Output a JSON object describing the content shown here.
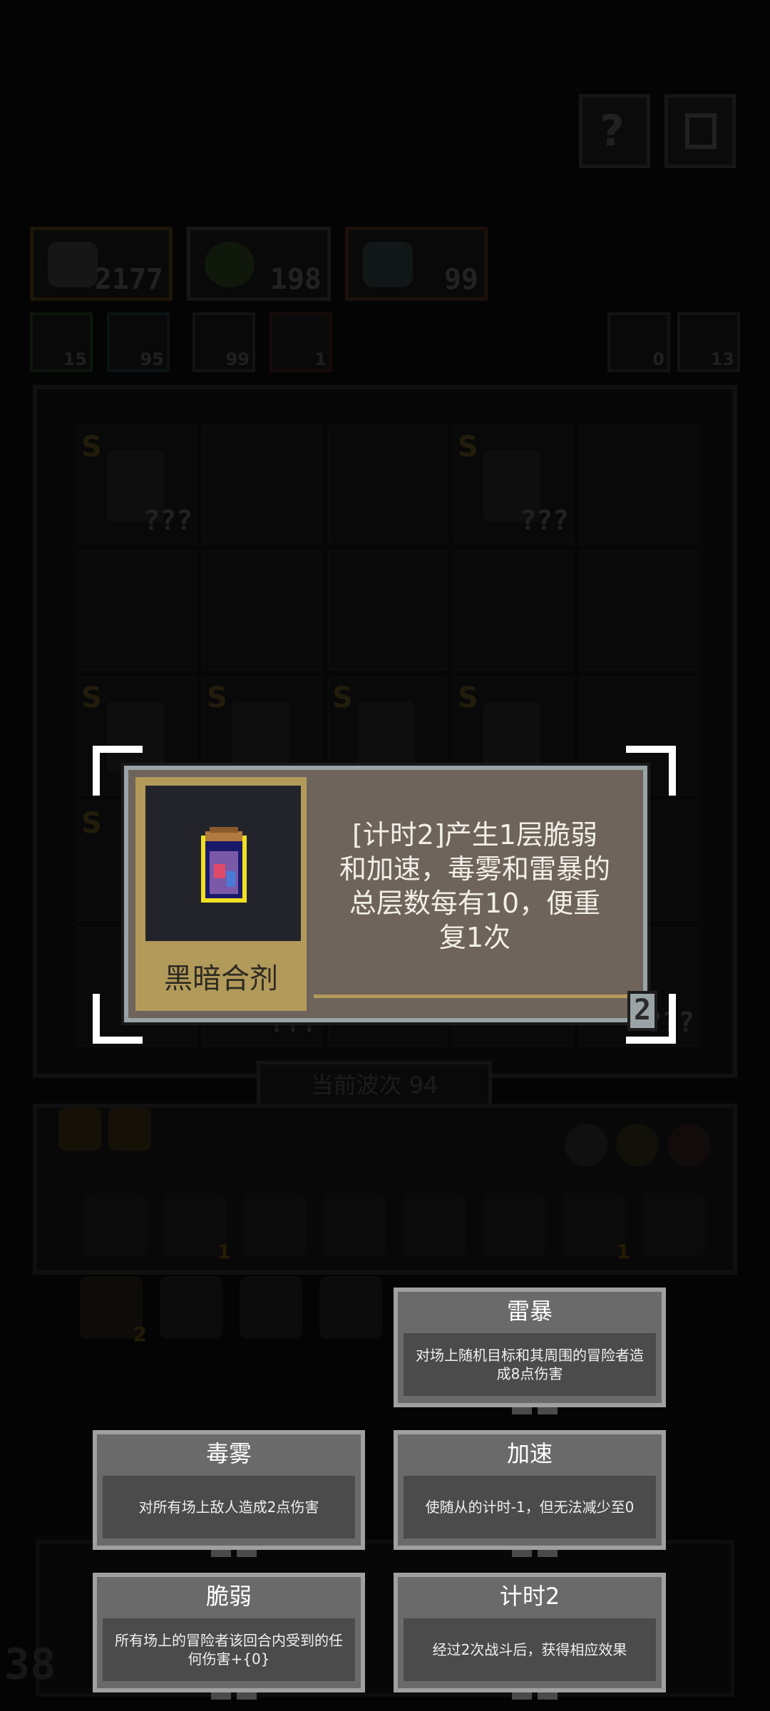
{
  "top_buttons": [
    {
      "icon": "question-icon"
    },
    {
      "icon": "pause-icon"
    }
  ],
  "stats": [
    {
      "icon": "shield-arrow-icon",
      "value": "2177",
      "color": "#6b5520"
    },
    {
      "icon": "green-orbs-icon",
      "value": "198",
      "color": "#2e4a22"
    },
    {
      "icon": "robot-icon",
      "value": "99",
      "color": "#5a2f1e"
    }
  ],
  "mini_stats": [
    {
      "icon": "leaf-icon",
      "value": "15"
    },
    {
      "icon": "swirl-icon",
      "value": "95"
    },
    {
      "icon": "wings-icon",
      "value": "99"
    },
    {
      "icon": "heart-icon",
      "value": "1"
    }
  ],
  "right_stats": [
    {
      "icon": "refresh-icon",
      "value": "0"
    },
    {
      "icon": "bolt-icon",
      "value": "13"
    }
  ],
  "board": {
    "rank_letter": "S",
    "unknown": "???"
  },
  "wave_label": "当前波次 94",
  "inventory_counts": [
    "1",
    "1",
    "2"
  ],
  "hud_left": "38",
  "item_card": {
    "name": "黑暗合剂",
    "description": "[计时2]产生1层脆弱和加速，毒雾和雷暴的总层数每有10，便重复1次",
    "level": "2",
    "icon": "dark-potion-icon"
  },
  "tooltips": [
    {
      "title": "雷暴",
      "body": "对场上随机目标和其周围的冒险者造成8点伤害"
    },
    {
      "title": "毒雾",
      "body": "对所有场上敌人造成2点伤害"
    },
    {
      "title": "加速",
      "body": "使随从的计时-1，但无法减少至0"
    },
    {
      "title": "脆弱",
      "body": "所有场上的冒险者该回合内受到的任何伤害+{0}"
    },
    {
      "title": "计时2",
      "body": "经过2次战斗后，获得相应效果"
    }
  ]
}
